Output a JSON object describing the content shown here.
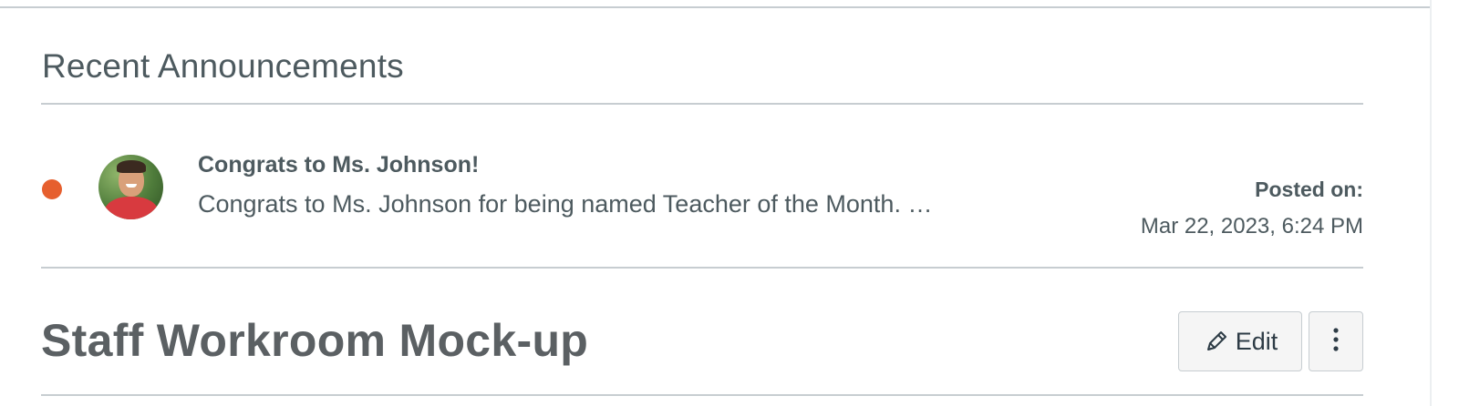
{
  "recent_announcements": {
    "heading": "Recent Announcements",
    "items": [
      {
        "unread": true,
        "unread_color": "#e65f2e",
        "avatar_icon": "user-avatar",
        "title": "Congrats to Ms. Johnson!",
        "snippet": "Congrats to Ms. Johnson for being named Teacher of the Month. …",
        "posted_label": "Posted on:",
        "posted_date": "Mar 22, 2023, 6:24 PM"
      }
    ]
  },
  "page": {
    "title": "Staff Workroom Mock-up",
    "edit_label": "Edit",
    "edit_icon": "pencil-icon",
    "more_icon": "more-vertical-icon"
  }
}
